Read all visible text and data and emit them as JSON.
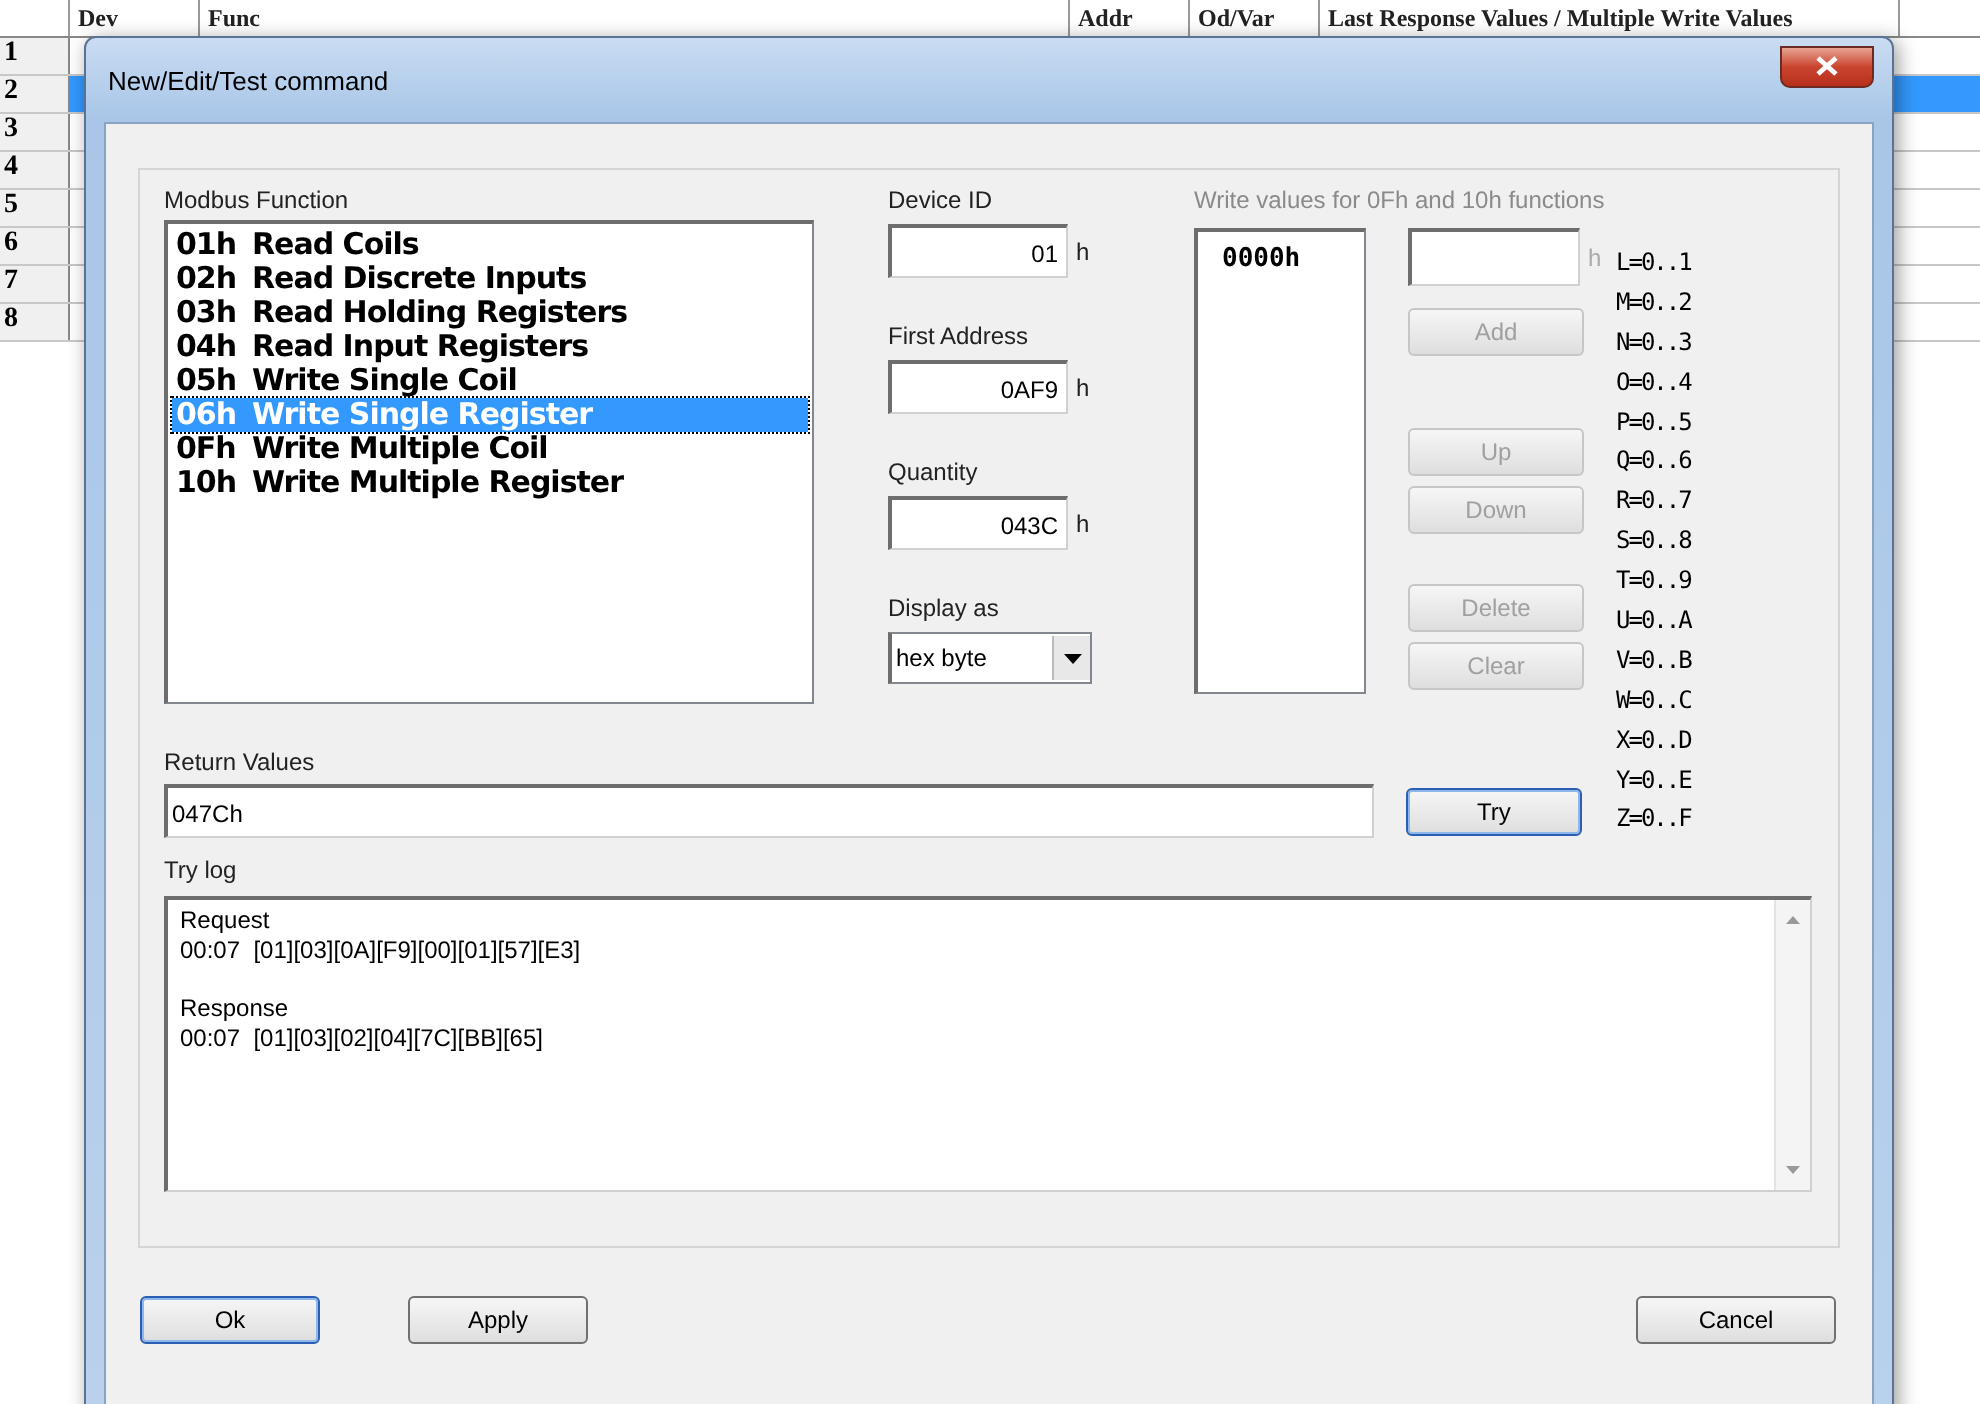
{
  "grid": {
    "columns": [
      "Dev",
      "Func",
      "Addr",
      "Od/Var",
      "Last Response Values / Multiple Write Values"
    ],
    "rows": [
      {
        "number": "1",
        "selected": false
      },
      {
        "number": "2",
        "selected": true
      },
      {
        "number": "3",
        "selected": false
      },
      {
        "number": "4",
        "selected": false
      },
      {
        "number": "5",
        "selected": false
      },
      {
        "number": "6",
        "selected": false
      },
      {
        "number": "7",
        "selected": false
      },
      {
        "number": "8",
        "selected": false
      }
    ]
  },
  "dialog": {
    "title": "New/Edit/Test command",
    "function_list": {
      "label": "Modbus Function",
      "items": [
        {
          "code": "01h",
          "name": "Read Coils",
          "selected": false
        },
        {
          "code": "02h",
          "name": "Read Discrete Inputs",
          "selected": false
        },
        {
          "code": "03h",
          "name": "Read Holding Registers",
          "selected": false
        },
        {
          "code": "04h",
          "name": "Read Input Registers",
          "selected": false
        },
        {
          "code": "05h",
          "name": "Write Single Coil",
          "selected": false
        },
        {
          "code": "06h",
          "name": "Write Single Register",
          "selected": true
        },
        {
          "code": "0Fh",
          "name": "Write Multiple Coil",
          "selected": false
        },
        {
          "code": "10h",
          "name": "Write Multiple Register",
          "selected": false
        }
      ]
    },
    "fields": [
      {
        "label": "Device ID",
        "value": "01",
        "unit": "h"
      },
      {
        "label": "First Address",
        "value": "0AF9",
        "unit": "h"
      },
      {
        "label": "Quantity",
        "value": "043C",
        "unit": "h"
      }
    ],
    "display_as": {
      "label": "Display as",
      "value": "hex byte"
    },
    "write_values": {
      "label": "Write values for 0Fh and 10h functions",
      "items": [
        "0000h"
      ],
      "input_unit": "h",
      "buttons": [
        {
          "label": "Add",
          "disabled": true
        },
        {
          "label": "Up",
          "disabled": true
        },
        {
          "label": "Down",
          "disabled": true
        },
        {
          "label": "Delete",
          "disabled": true
        },
        {
          "label": "Clear",
          "disabled": true
        }
      ]
    },
    "legend": [
      "L=0..1",
      "M=0..2",
      "N=0..3",
      "O=0..4",
      "P=0..5",
      "Q=0..6",
      "R=0..7",
      "S=0..8",
      "T=0..9",
      "U=0..A",
      "V=0..B",
      "W=0..C",
      "X=0..D",
      "Y=0..E",
      "Z=0..F"
    ],
    "return_values": {
      "label": "Return Values",
      "value": "047Ch"
    },
    "try_button": {
      "label": "Try",
      "default": true
    },
    "try_log": {
      "label": "Try log",
      "entries": [
        {
          "title": "Request",
          "data": "00:07  [01][03][0A][F9][00][01][57][E3]"
        },
        {
          "title": "Response",
          "data": "00:07  [01][03][02][04][7C][BB][65]"
        }
      ]
    },
    "buttons": [
      {
        "label": "Ok",
        "default": true
      },
      {
        "label": "Apply",
        "default": false
      },
      {
        "label": "Cancel",
        "default": false
      }
    ]
  }
}
